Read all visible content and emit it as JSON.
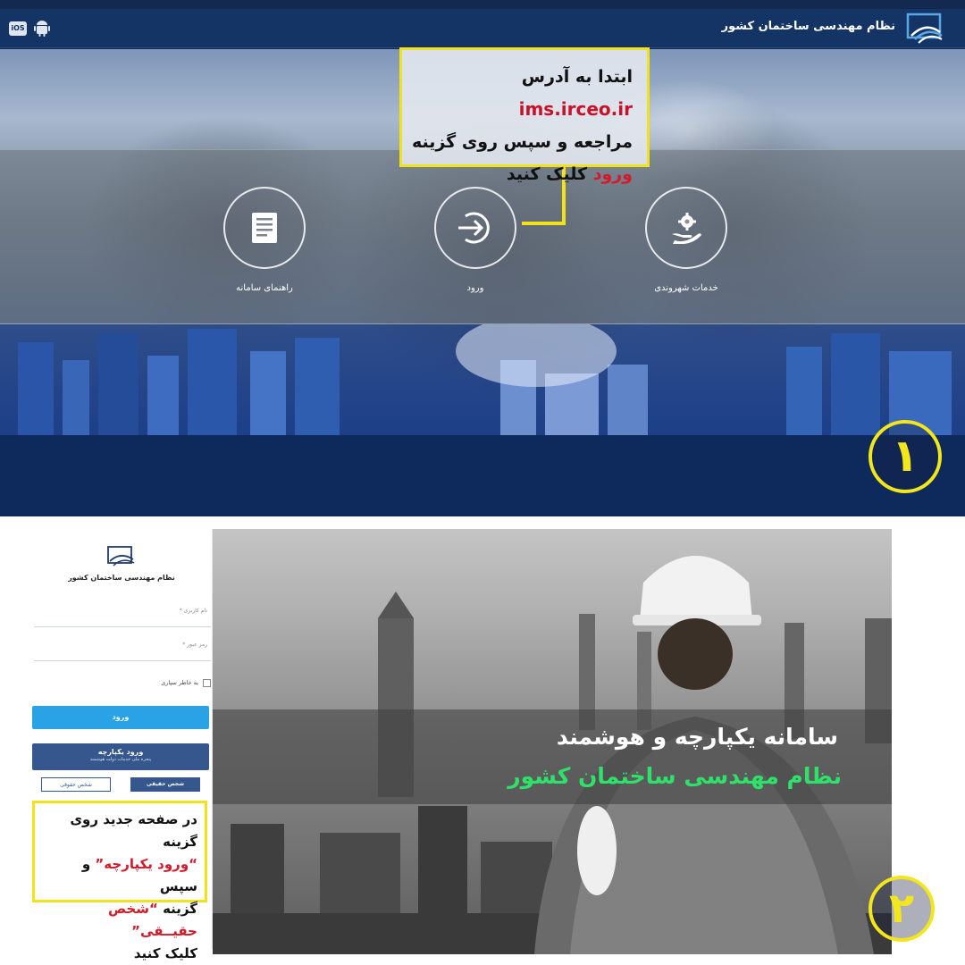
{
  "panel1": {
    "header": {
      "title": "نظام مهندسی ساختمان کشور",
      "os_ios": "iOS",
      "os_android_icon": "android-icon",
      "logo_icon": "irceo-logo-icon"
    },
    "services": [
      {
        "label": "خدمات شهروندی",
        "icon": "gear-hand-icon"
      },
      {
        "label": "ورود",
        "icon": "login-arrow-icon"
      },
      {
        "label": "راهنمای سامانه",
        "icon": "document-icon"
      }
    ],
    "callout": {
      "line1_prefix": "ابتدا به آدرس",
      "url": "ims.irceo.ir",
      "line2": "مراجعه و سپس روی گزینه",
      "line3_highlight": "ورود",
      "line3_rest": " کلیک کنید"
    },
    "step_number": "۱",
    "colors": {
      "navy": "#133465",
      "highlight_yellow": "#f2e21a",
      "highlight_red": "#d11b2a"
    }
  },
  "panel2": {
    "login": {
      "title": "نظام مهندسی ساختمان کشور",
      "username_placeholder": "نام کاربری *",
      "password_placeholder": "رمز عبور *",
      "remember_label": "به خاطر سپاری",
      "login_button": "ورود",
      "sso_button": "ورود یکپارچه",
      "sso_subtitle": "پنجره ملی خدمات دولت هوشمند",
      "real_person": "شخص حقیقی",
      "legal_person": "شخص حقوقی"
    },
    "callout": {
      "line1": "در صفحه جدید روی گزینه",
      "line2_highlight": "“ورود یکپارچه”",
      "line2_rest": " و سپس",
      "line3_prefix": "گزینه ",
      "line3_highlight": "“شخص حقیــقی”",
      "line4": "کلیک کنید"
    },
    "hero": {
      "line1": "سامانه یکپارچه و هوشمند",
      "line2": "نظام مهندسی ساختمان کشور"
    },
    "step_number": "۲",
    "colors": {
      "accent_green": "#2fe06a",
      "button_blue": "#2aa3e6",
      "sso_navy": "#36568e"
    }
  }
}
